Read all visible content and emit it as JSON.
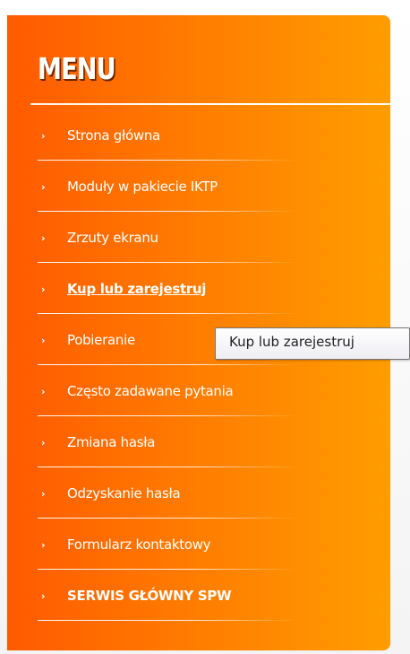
{
  "menu": {
    "title": "MENU",
    "bullet": "›",
    "items": [
      {
        "label": "Strona główna",
        "style": "normal"
      },
      {
        "label": "Moduły w pakiecie IKTP",
        "style": "normal"
      },
      {
        "label": "Zrzuty ekranu",
        "style": "normal"
      },
      {
        "label": "Kup lub zarejestruj",
        "style": "active"
      },
      {
        "label": "Pobieranie",
        "style": "normal"
      },
      {
        "label": "Często zadawane pytania",
        "style": "normal"
      },
      {
        "label": "Zmiana hasła",
        "style": "normal"
      },
      {
        "label": "Odzyskanie hasła",
        "style": "normal"
      },
      {
        "label": "Formularz kontaktowy",
        "style": "normal"
      },
      {
        "label": "SERWIS GŁÓWNY SPW",
        "style": "strong"
      }
    ]
  },
  "tooltip": {
    "text": "Kup lub zarejestruj"
  },
  "colors": {
    "panel_start": "#ff5a00",
    "panel_end": "#ff9d00",
    "text": "#ffffff"
  }
}
